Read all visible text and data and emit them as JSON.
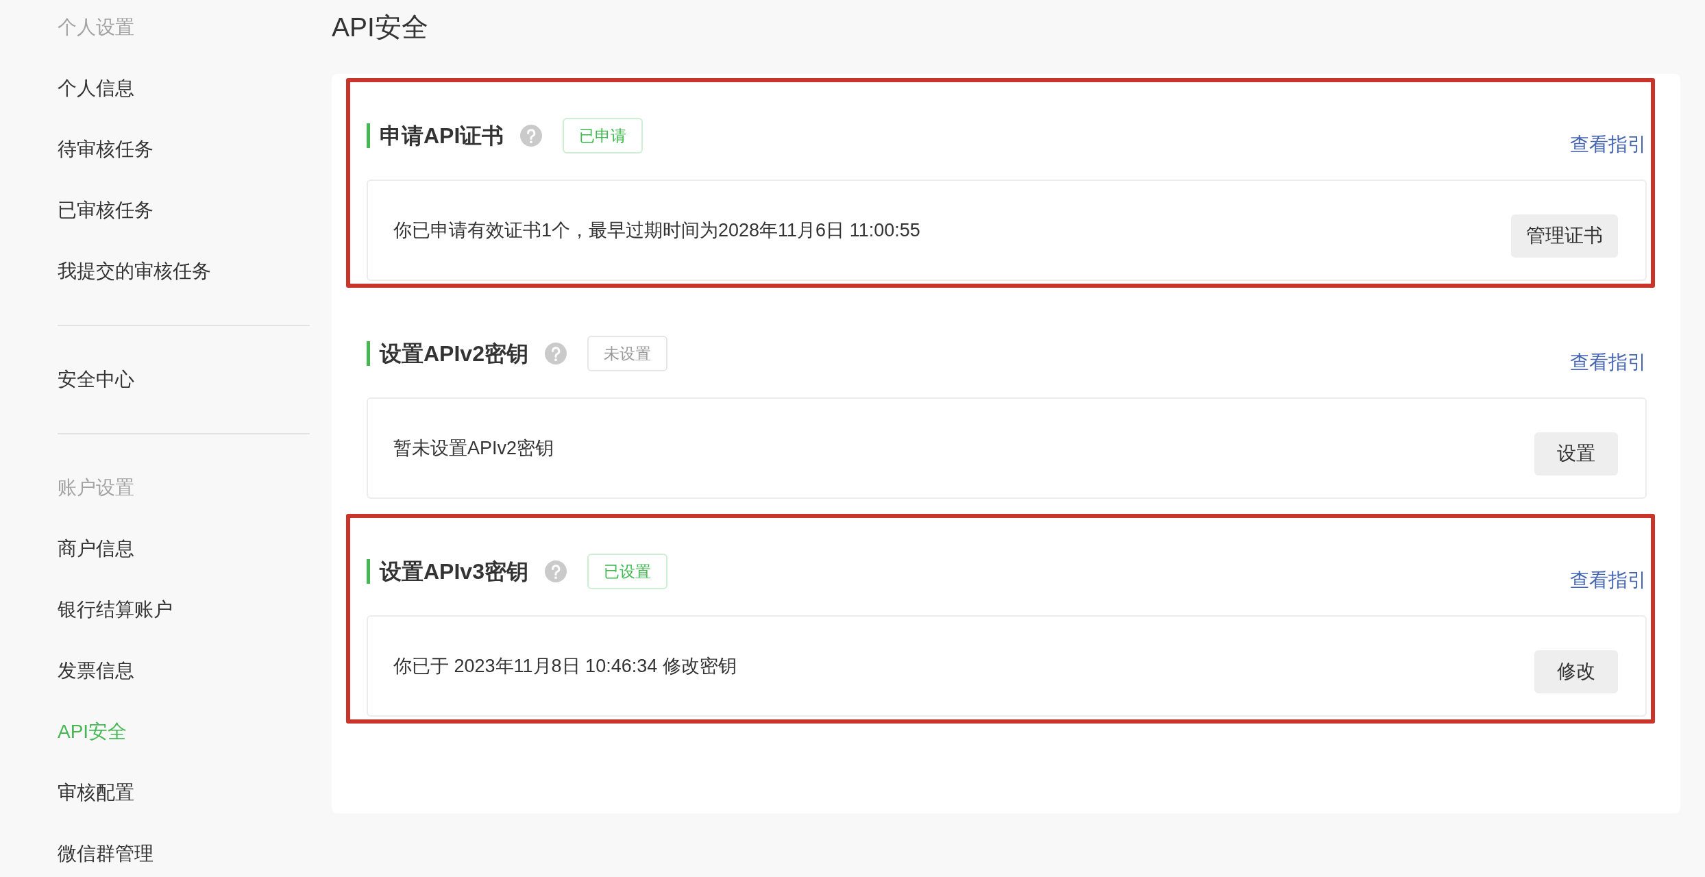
{
  "sidebar": {
    "groups": [
      {
        "title": "个人设置",
        "items": [
          {
            "label": "个人信息",
            "selected": false
          },
          {
            "label": "待审核任务",
            "selected": false
          },
          {
            "label": "已审核任务",
            "selected": false
          },
          {
            "label": "我提交的审核任务",
            "selected": false
          }
        ]
      },
      {
        "items": [
          {
            "label": "安全中心",
            "selected": false
          }
        ]
      },
      {
        "title": "账户设置",
        "items": [
          {
            "label": "商户信息",
            "selected": false
          },
          {
            "label": "银行结算账户",
            "selected": false
          },
          {
            "label": "发票信息",
            "selected": false
          },
          {
            "label": "API安全",
            "selected": true
          },
          {
            "label": "审核配置",
            "selected": false
          },
          {
            "label": "微信群管理",
            "selected": false
          }
        ]
      }
    ]
  },
  "page_title": "API安全",
  "sections": [
    {
      "title": "申请API证书",
      "badge": {
        "label": "已申请",
        "active": true
      },
      "guide_link": "查看指引",
      "message": "你已申请有效证书1个，最早过期时间为2028年11月6日 11:00:55",
      "button": "管理证书",
      "highlighted": true
    },
    {
      "title": "设置APIv2密钥",
      "badge": {
        "label": "未设置",
        "active": false
      },
      "guide_link": "查看指引",
      "message": "暂未设置APIv2密钥",
      "button": "设置",
      "highlighted": false
    },
    {
      "title": "设置APIv3密钥",
      "badge": {
        "label": "已设置",
        "active": true
      },
      "guide_link": "查看指引",
      "message": "你已于 2023年11月8日 10:46:34 修改密钥",
      "button": "修改",
      "highlighted": true
    }
  ]
}
